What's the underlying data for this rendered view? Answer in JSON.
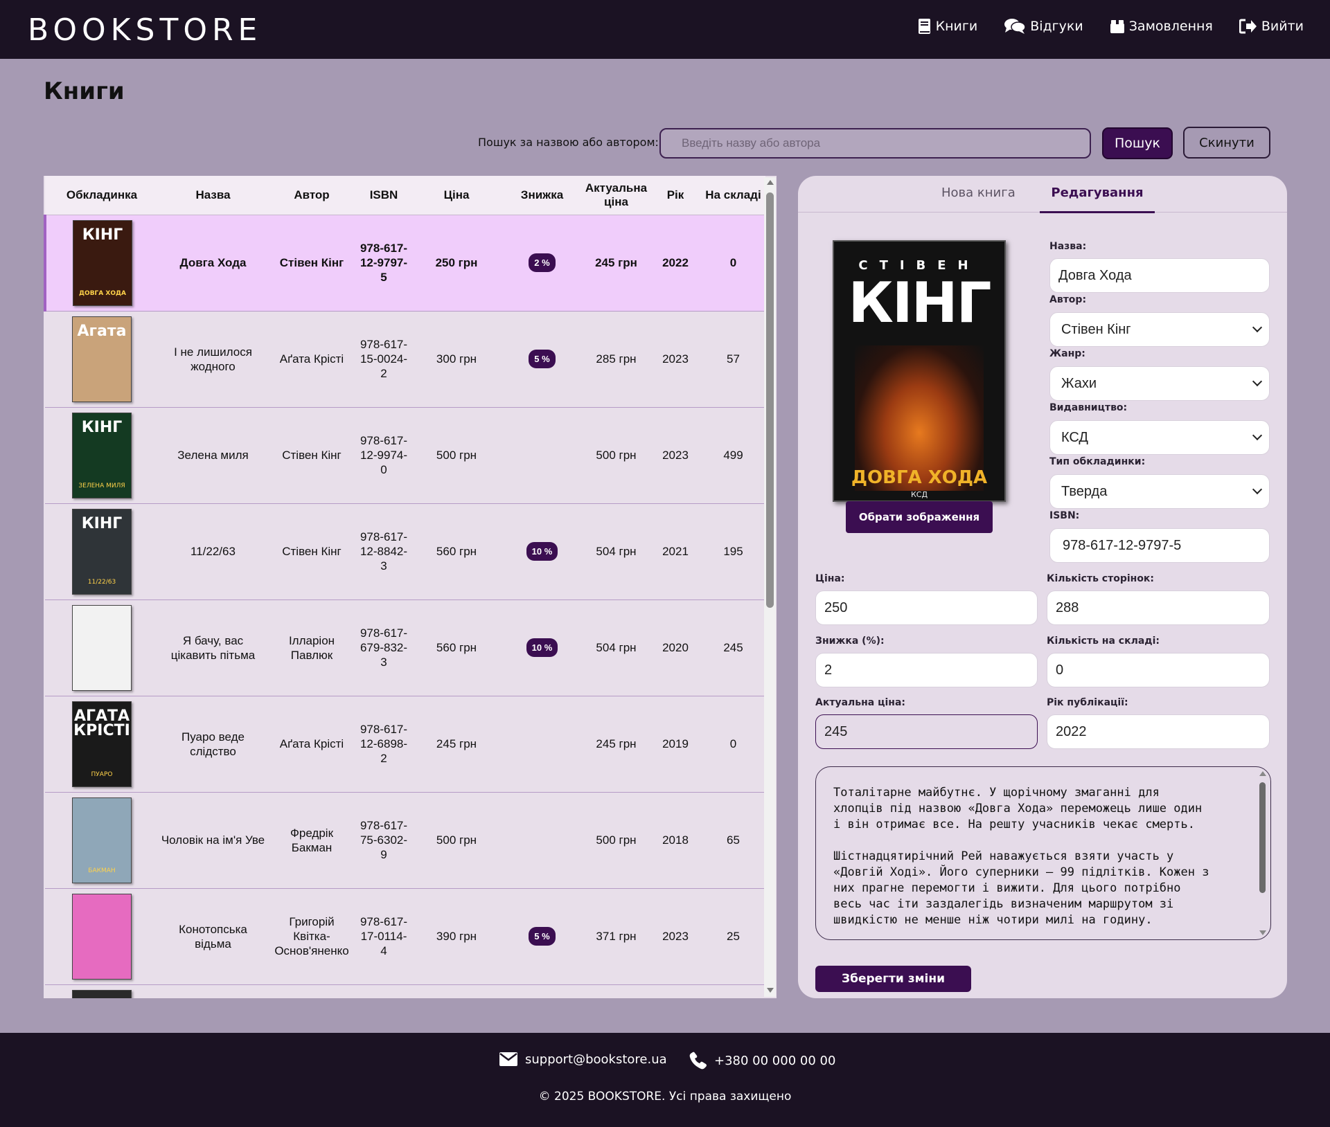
{
  "header": {
    "logo": "BOOKSTORE",
    "nav": [
      {
        "label": "Книги",
        "icon": "book-icon"
      },
      {
        "label": "Відгуки",
        "icon": "comments-icon"
      },
      {
        "label": "Замовлення",
        "icon": "box-icon"
      },
      {
        "label": "Вийти",
        "icon": "logout-icon"
      }
    ]
  },
  "page": {
    "title": "Книги"
  },
  "search": {
    "label": "Пошук за назвою або автором:",
    "placeholder": "Введіть назву або автора",
    "value": "",
    "search_button": "Пошук",
    "reset_button": "Скинути"
  },
  "table": {
    "columns": [
      "Обкладинка",
      "Назва",
      "Автор",
      "ISBN",
      "Ціна",
      "Знижка",
      "Актуальна ціна",
      "Рік",
      "На складі"
    ],
    "rows": [
      {
        "title": "Довга Хода",
        "author": "Стівен Кінг",
        "isbn": "978-617-12-9797-5",
        "price": "250 грн",
        "discount": "2 %",
        "actual": "245 грн",
        "year": "2022",
        "stock": "0",
        "cover_text": "КІНГ",
        "cover_sub": "ДОВГА ХОДА",
        "cover_color": "#3a1a10",
        "selected": true
      },
      {
        "title": "І не лишилося жодного",
        "author": "Аґата Крісті",
        "isbn": "978-617-15-0024-2",
        "price": "300 грн",
        "discount": "5 %",
        "actual": "285 грн",
        "year": "2023",
        "stock": "57",
        "cover_text": "Агата",
        "cover_sub": "",
        "cover_color": "#c9a37a",
        "selected": false
      },
      {
        "title": "Зелена миля",
        "author": "Стівен Кінг",
        "isbn": "978-617-12-9974-0",
        "price": "500 грн",
        "discount": "",
        "actual": "500 грн",
        "year": "2023",
        "stock": "499",
        "cover_text": "КІНГ",
        "cover_sub": "ЗЕЛЕНА МИЛЯ",
        "cover_color": "#143a22",
        "selected": false
      },
      {
        "title": "11/22/63",
        "author": "Стівен Кінг",
        "isbn": "978-617-12-8842-3",
        "price": "560 грн",
        "discount": "10 %",
        "actual": "504 грн",
        "year": "2021",
        "stock": "195",
        "cover_text": "КІНГ",
        "cover_sub": "11/22/63",
        "cover_color": "#2f3438",
        "selected": false
      },
      {
        "title": "Я бачу, вас цікавить пітьма",
        "author": "Ілларіон Павлюк",
        "isbn": "978-617-679-832-3",
        "price": "560 грн",
        "discount": "10 %",
        "actual": "504 грн",
        "year": "2020",
        "stock": "245",
        "cover_text": "",
        "cover_sub": "",
        "cover_color": "#f2f2f2",
        "selected": false
      },
      {
        "title": "Пуаро веде слідство",
        "author": "Аґата Крісті",
        "isbn": "978-617-12-6898-2",
        "price": "245 грн",
        "discount": "",
        "actual": "245 грн",
        "year": "2019",
        "stock": "0",
        "cover_text": "АГАТА КРІСТІ",
        "cover_sub": "ПУАРО",
        "cover_color": "#1a1a1a",
        "selected": false
      },
      {
        "title": "Чоловік на ім'я Уве",
        "author": "Фредрік Бакман",
        "isbn": "978-617-75-6302-9",
        "price": "500 грн",
        "discount": "",
        "actual": "500 грн",
        "year": "2018",
        "stock": "65",
        "cover_text": "",
        "cover_sub": "БАКМАН",
        "cover_color": "#8fa7b8",
        "selected": false
      },
      {
        "title": "Конотопська відьма",
        "author": "Григорій Квітка-Основ'яненко",
        "isbn": "978-617-17-0114-4",
        "price": "390 грн",
        "discount": "5 %",
        "actual": "371 грн",
        "year": "2023",
        "stock": "25",
        "cover_text": "",
        "cover_sub": "",
        "cover_color": "#e66bc0",
        "selected": false
      },
      {
        "title": "",
        "author": "",
        "isbn": "",
        "price": "",
        "discount": "",
        "actual": "",
        "year": "",
        "stock": "",
        "cover_text": "",
        "cover_sub": "",
        "cover_color": "#2a2a2a",
        "selected": false
      }
    ]
  },
  "editor": {
    "tab_new": "Нова книга",
    "tab_edit": "Редагування",
    "cover": {
      "author": "СТІВЕН",
      "name": "КІНГ",
      "title": "ДОВГА ХОДА",
      "publisher": "КСД"
    },
    "choose_image": "Обрати зображення",
    "labels": {
      "name": "Назва:",
      "author": "Автор:",
      "genre": "Жанр:",
      "publisher": "Видавництво:",
      "cover_type": "Тип обкладинки:",
      "isbn": "ISBN:",
      "price": "Ціна:",
      "pages": "Кількість сторінок:",
      "discount": "Знижка (%):",
      "stock": "Кількість на складі:",
      "actual_price": "Актуальна ціна:",
      "year": "Рік публікації:"
    },
    "values": {
      "name": "Довга Хода",
      "author": "Стівен Кінг",
      "genre": "Жахи",
      "publisher": "КСД",
      "cover_type": "Тверда",
      "isbn": "978-617-12-9797-5",
      "price": "250",
      "pages": "288",
      "discount": "2",
      "stock": "0",
      "actual_price": "245",
      "year": "2022"
    },
    "description": "Тоталітарне майбутнє. У щорічному змаганні для\nхлопців під назвою «Довга Хода» переможець лише один\nі він отримає все. На решту учасників чекає смерть.\n\nШістнадцятирічний Рей наважується взяти участь у\n«Довгій Ході». Його суперники — 99 підлітків. Кожен з\nних прагне перемогти і вижити. Для цього потрібно\nвесь час іти заздалегідь визначеним маршрутом зі\nшвидкістю не менше ніж чотири милі на годину.",
    "save_button": "Зберегти зміни"
  },
  "footer": {
    "email": "support@bookstore.ua",
    "phone": "+380 00 000 00 00",
    "copyright": "© 2025 BOOKSTORE. Усі права захищено"
  },
  "colors": {
    "brand": "#3b0e51",
    "header_bg": "#1b1223",
    "page_bg": "#a69ab3",
    "selected_row": "#f0cdfb"
  }
}
